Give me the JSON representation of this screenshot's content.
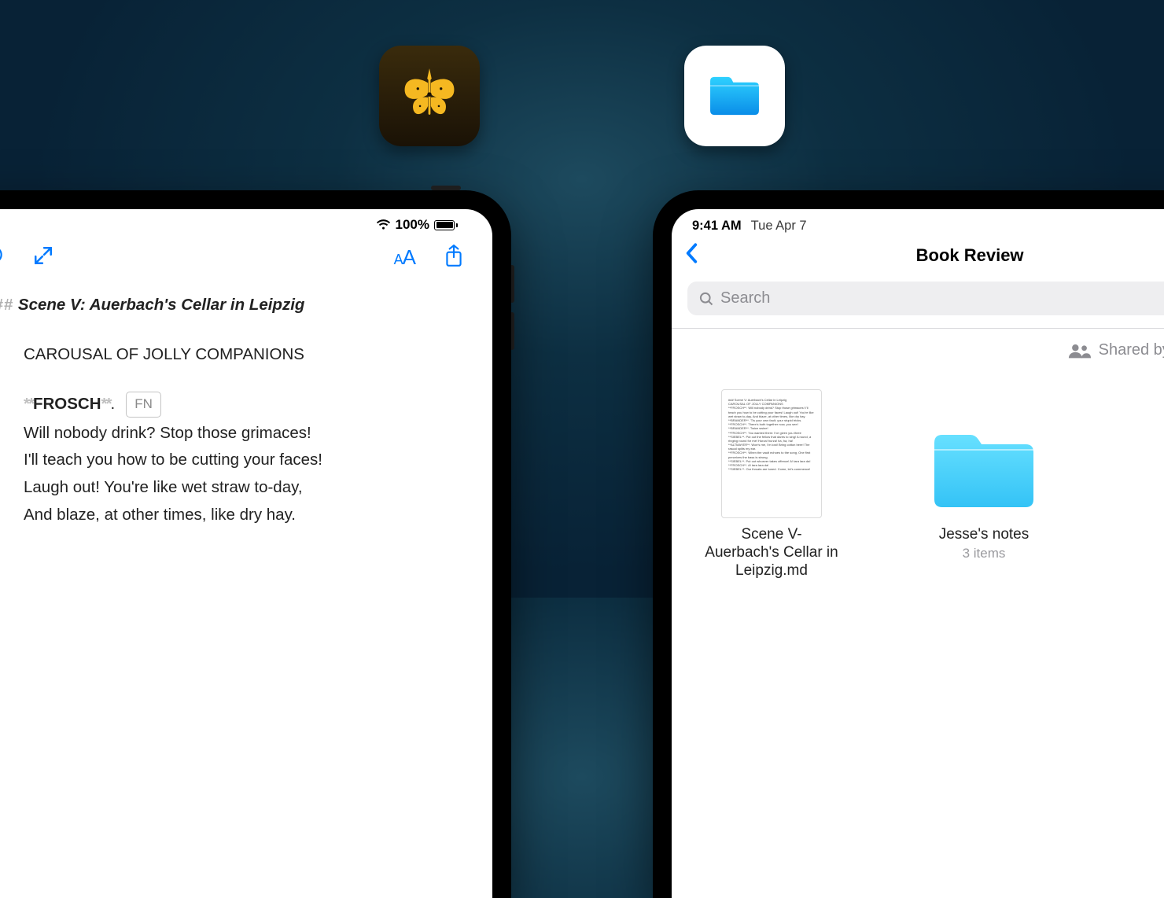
{
  "app_icons": {
    "ulysses": "ulysses-app-icon",
    "files": "files-app-icon"
  },
  "left": {
    "status": {
      "battery_pct": "100%"
    },
    "editor": {
      "heading_prefix": "###",
      "heading": "Scene V: Auerbach's Cellar in Leipzig",
      "subheading": "CAROUSAL OF JOLLY COMPANIONS",
      "speaker_marker": "**",
      "speaker": "FROSCH",
      "speaker_dot": ".",
      "fn_label": "FN",
      "verses": [
        "Will nobody drink? Stop those grimaces!",
        "I'll teach you how to be cutting your faces!",
        "Laugh out! You're like wet straw to-day,",
        "And blaze, at other times, like dry hay."
      ]
    }
  },
  "right": {
    "status": {
      "time": "9:41 AM",
      "date": "Tue Apr 7"
    },
    "title": "Book Review",
    "search_placeholder": "Search",
    "shared_label": "Shared by M",
    "items": [
      {
        "name": "Scene V- Auerbach's Cellar in Leipzig.md",
        "meta": ""
      },
      {
        "name": "Jesse's notes",
        "meta": "3 items"
      }
    ]
  },
  "colors": {
    "accent": "#007aff",
    "folder": "#3ec7ff"
  }
}
